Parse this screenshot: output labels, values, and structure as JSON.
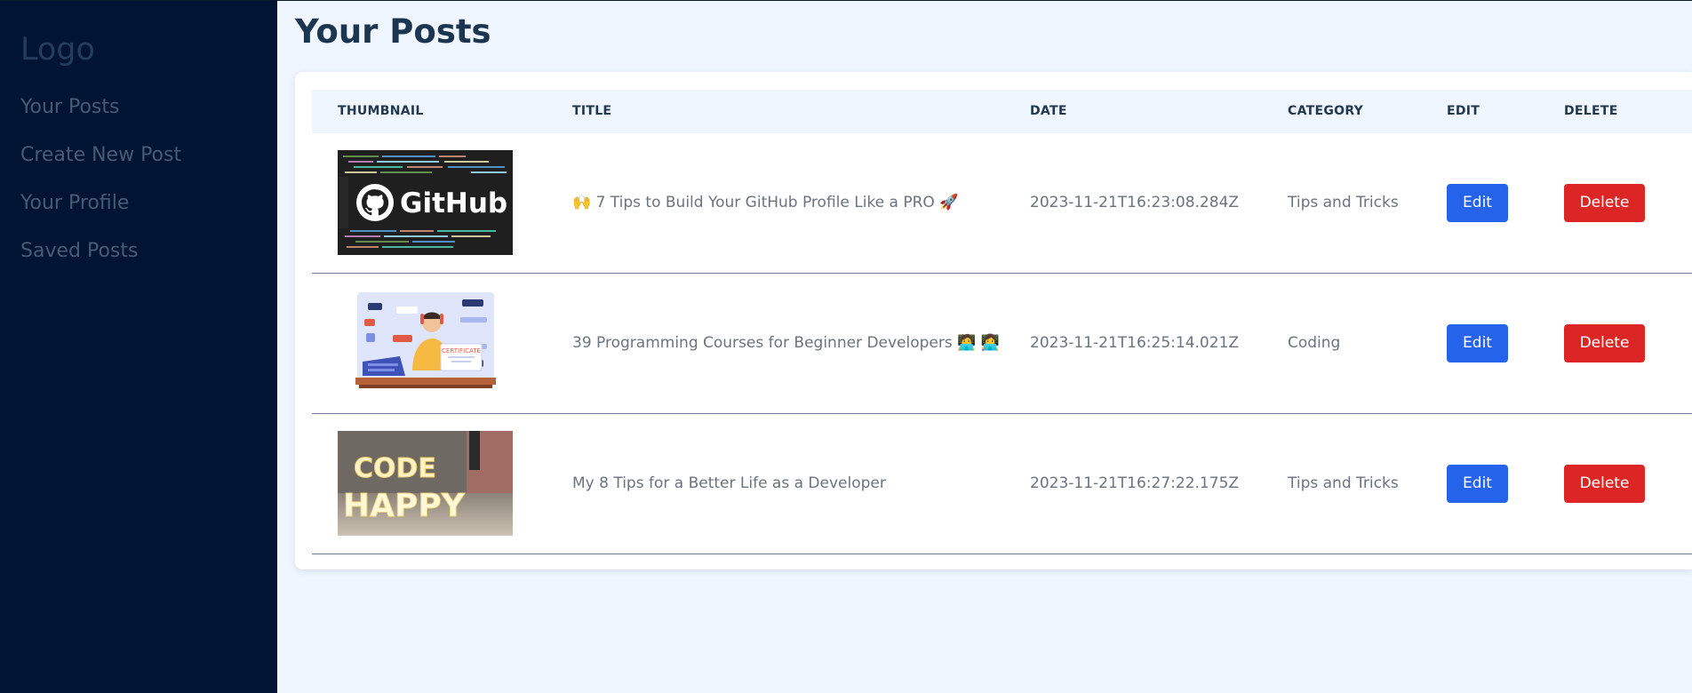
{
  "sidebar": {
    "logo": "Logo",
    "items": [
      {
        "label": "Your Posts"
      },
      {
        "label": "Create New Post"
      },
      {
        "label": "Your Profile"
      },
      {
        "label": "Saved Posts"
      }
    ]
  },
  "main": {
    "title": "Your Posts",
    "table": {
      "columns": [
        "THUMBNAIL",
        "TITLE",
        "DATE",
        "CATEGORY",
        "EDIT",
        "DELETE"
      ],
      "rows": [
        {
          "thumbnail": "github-image",
          "thumbnail_text": "GitHub",
          "title": "🙌 7 Tips to Build Your GitHub Profile Like a PRO 🚀",
          "date": "2023-11-21T16:23:08.284Z",
          "category": "Tips and Tricks",
          "edit_label": "Edit",
          "delete_label": "Delete"
        },
        {
          "thumbnail": "developer-certificate-illustration",
          "thumbnail_text": "CERTIFICATE",
          "title": "39 Programming Courses for Beginner Developers 🧑‍💻 👩‍💻",
          "date": "2023-11-21T16:25:14.021Z",
          "category": "Coding",
          "edit_label": "Edit",
          "delete_label": "Delete"
        },
        {
          "thumbnail": "code-happy-lights-photo",
          "thumbnail_text": [
            "CODE",
            "HAPPY"
          ],
          "title": "My 8 Tips for a Better Life as a Developer",
          "date": "2023-11-21T16:27:22.175Z",
          "category": "Tips and Tricks",
          "edit_label": "Edit",
          "delete_label": "Delete"
        }
      ]
    }
  },
  "colors": {
    "sidebar_bg": "#011433",
    "page_bg": "#eff6ff",
    "edit_button": "#2563eb",
    "delete_button": "#dc2626"
  }
}
